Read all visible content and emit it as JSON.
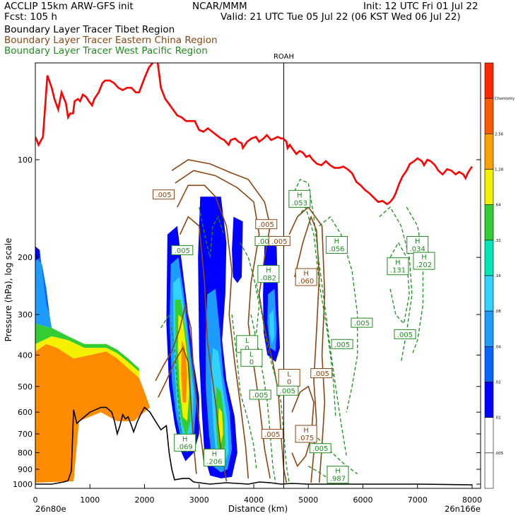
{
  "header": {
    "model": "ACCLIP 15km ARW-GFS init",
    "org": "NCAR/MMM",
    "init": "Init: 12 UTC Fri 01 Jul 22",
    "fcst": "Fcst:  105 h",
    "valid": "Valid: 21 UTC Tue 05 Jul 22 (06 KST Wed 06 Jul 22)",
    "lines": [
      "Boundary Layer Tracer  Tibet Region",
      "Boundary Layer Tracer  Eastern China Region",
      "Boundary Layer Tracer  West Pacific Region"
    ]
  },
  "chart_data": {
    "type": "heatmap",
    "xlabel": "Distance (km)",
    "ylabel": "Pressure (hPa), log scale",
    "xlim": [
      0,
      8000
    ],
    "ylim": [
      1000,
      50
    ],
    "x_ticks": [
      "0",
      "1000",
      "2000",
      "3000",
      "4000",
      "5000",
      "6000",
      "7000",
      "8000"
    ],
    "y_ticks": [
      {
        "p": 100,
        "label": "100"
      },
      {
        "p": 200,
        "label": "200"
      },
      {
        "p": 300,
        "label": "300"
      },
      {
        "p": 400,
        "label": "400"
      },
      {
        "p": 500,
        "label": "500"
      },
      {
        "p": 600,
        "label": "600"
      },
      {
        "p": 700,
        "label": "700"
      },
      {
        "p": 800,
        "label": "800"
      },
      {
        "p": 900,
        "label": "900"
      },
      {
        "p": 1000,
        "label": "1000"
      }
    ],
    "x_start_label": "26n80e",
    "x_end_label": "26n166e",
    "marker": {
      "label": "ROAH",
      "x": 4550
    },
    "colorbar": {
      "levels": [
        ".005",
        ".01",
        ".02",
        ".04",
        ".08",
        ".16",
        ".32",
        ".64",
        "1.28",
        "2.56",
        "Chemistry"
      ],
      "colors": [
        "#ffffff",
        "#ffffff",
        "#0000ff",
        "#0a64ff",
        "#1e9bff",
        "#32d2ff",
        "#00e6b4",
        "#32cd32",
        "#f0f000",
        "#ffa000",
        "#ff5a00",
        "#ff2800"
      ]
    },
    "series": [
      {
        "name": "Boundary Layer Tracer  Tibet Region",
        "color": "#ff7f00"
      },
      {
        "name": "Boundary Layer Tracer  Eastern China Region",
        "color": "#8b4513"
      },
      {
        "name": "Boundary Layer Tracer  West Pacific Region",
        "color": "#1e8c1e"
      }
    ],
    "tropopause": {
      "color": "#ff0000",
      "points": [
        [
          0,
          85
        ],
        [
          60,
          90
        ],
        [
          140,
          85
        ],
        [
          220,
          55
        ],
        [
          300,
          60
        ],
        [
          350,
          65
        ],
        [
          420,
          70
        ],
        [
          480,
          62
        ],
        [
          560,
          67
        ],
        [
          600,
          74
        ],
        [
          640,
          72
        ],
        [
          690,
          72
        ],
        [
          720,
          66
        ],
        [
          780,
          65
        ],
        [
          820,
          66
        ],
        [
          870,
          63
        ],
        [
          930,
          64
        ],
        [
          980,
          66
        ],
        [
          1040,
          68
        ],
        [
          1080,
          65
        ],
        [
          1160,
          62
        ],
        [
          1230,
          58
        ],
        [
          1280,
          57
        ],
        [
          1360,
          57
        ],
        [
          1440,
          58
        ],
        [
          1520,
          60
        ],
        [
          1600,
          61
        ],
        [
          1680,
          60
        ],
        [
          1760,
          60
        ],
        [
          1840,
          62
        ],
        [
          1900,
          62
        ],
        [
          2000,
          56
        ],
        [
          2080,
          52
        ],
        [
          2160,
          50
        ],
        [
          2240,
          50
        ],
        [
          2300,
          60
        ],
        [
          2380,
          65
        ],
        [
          2440,
          67
        ],
        [
          2520,
          70
        ],
        [
          2600,
          73
        ],
        [
          2680,
          74
        ],
        [
          2760,
          76
        ],
        [
          2840,
          76
        ],
        [
          2920,
          76
        ],
        [
          3000,
          81
        ],
        [
          3080,
          82
        ],
        [
          3160,
          80
        ],
        [
          3240,
          82
        ],
        [
          3320,
          84
        ],
        [
          3400,
          86
        ],
        [
          3460,
          87
        ],
        [
          3540,
          90
        ],
        [
          3580,
          87
        ],
        [
          3660,
          86
        ],
        [
          3720,
          88
        ],
        [
          3780,
          89
        ],
        [
          3800,
          92
        ],
        [
          3880,
          88
        ],
        [
          3960,
          86
        ],
        [
          4040,
          85
        ],
        [
          4100,
          88
        ],
        [
          4180,
          86
        ],
        [
          4240,
          84
        ],
        [
          4320,
          87
        ],
        [
          4380,
          86
        ],
        [
          4440,
          85
        ],
        [
          4500,
          86
        ],
        [
          4540,
          86
        ],
        [
          4600,
          88
        ],
        [
          4620,
          92
        ],
        [
          4660,
          90
        ],
        [
          4720,
          93
        ],
        [
          4780,
          96
        ],
        [
          4840,
          94
        ],
        [
          4900,
          95
        ],
        [
          4960,
          98
        ],
        [
          5020,
          97
        ],
        [
          5080,
          100
        ],
        [
          5160,
          103
        ],
        [
          5240,
          104
        ],
        [
          5320,
          101
        ],
        [
          5400,
          104
        ],
        [
          5480,
          106
        ],
        [
          5560,
          106
        ],
        [
          5640,
          105
        ],
        [
          5720,
          107
        ],
        [
          5800,
          110
        ],
        [
          5880,
          117
        ],
        [
          5960,
          120
        ],
        [
          6040,
          124
        ],
        [
          6120,
          127
        ],
        [
          6200,
          131
        ],
        [
          6280,
          135
        ],
        [
          6360,
          134
        ],
        [
          6440,
          137
        ],
        [
          6500,
          135
        ],
        [
          6560,
          131
        ],
        [
          6600,
          127
        ],
        [
          6660,
          119
        ],
        [
          6720,
          113
        ],
        [
          6800,
          108
        ],
        [
          6860,
          103
        ],
        [
          6940,
          101
        ],
        [
          7000,
          99
        ],
        [
          7080,
          101
        ],
        [
          7120,
          104
        ],
        [
          7180,
          100
        ],
        [
          7240,
          101
        ],
        [
          7320,
          104
        ],
        [
          7380,
          108
        ],
        [
          7460,
          111
        ],
        [
          7540,
          107
        ],
        [
          7620,
          108
        ],
        [
          7700,
          111
        ],
        [
          7760,
          109
        ],
        [
          7840,
          111
        ],
        [
          7880,
          114
        ],
        [
          7920,
          110
        ],
        [
          7980,
          106
        ],
        [
          8000,
          105
        ]
      ]
    },
    "terrain": [
      [
        0,
        1000
      ],
      [
        300,
        1000
      ],
      [
        520,
        985
      ],
      [
        600,
        975
      ],
      [
        660,
        910
      ],
      [
        700,
        590
      ],
      [
        760,
        650
      ],
      [
        850,
        630
      ],
      [
        1000,
        600
      ],
      [
        1200,
        580
      ],
      [
        1300,
        580
      ],
      [
        1400,
        600
      ],
      [
        1450,
        640
      ],
      [
        1500,
        700
      ],
      [
        1550,
        660
      ],
      [
        1600,
        610
      ],
      [
        1650,
        630
      ],
      [
        1700,
        620
      ],
      [
        1760,
        660
      ],
      [
        1800,
        690
      ],
      [
        1870,
        640
      ],
      [
        1950,
        600
      ],
      [
        2000,
        580
      ],
      [
        2050,
        590
      ],
      [
        2100,
        600
      ],
      [
        2200,
        640
      ],
      [
        2300,
        680
      ],
      [
        2400,
        660
      ],
      [
        2450,
        800
      ],
      [
        2500,
        900
      ],
      [
        2550,
        970
      ],
      [
        2700,
        960
      ],
      [
        2820,
        960
      ],
      [
        2900,
        985
      ],
      [
        3000,
        990
      ],
      [
        3200,
        1000
      ],
      [
        3500,
        990
      ],
      [
        3900,
        1000
      ],
      [
        4100,
        985
      ],
      [
        4300,
        990
      ],
      [
        4500,
        1000
      ],
      [
        4700,
        995
      ],
      [
        5000,
        1000
      ],
      [
        6000,
        1000
      ],
      [
        7000,
        1000
      ],
      [
        8000,
        1005
      ]
    ],
    "labels": [
      {
        "x": 2350,
        "p": 128,
        "text": ".005",
        "color": "#8b4513"
      },
      {
        "x": 4230,
        "p": 158,
        "text": ".005",
        "color": "#8b4513"
      },
      {
        "x": 4220,
        "p": 178,
        "text": ".005",
        "color": "#1e8c1e"
      },
      {
        "x": 4470,
        "p": 178,
        "text": ".005",
        "color": "#8b4513"
      },
      {
        "x": 2690,
        "p": 190,
        "text": ".005",
        "color": "#1e8c1e"
      },
      {
        "x": 4840,
        "p": 132,
        "text": ".053",
        "color": "#1e8c1e",
        "h": "H"
      },
      {
        "x": 5520,
        "p": 183,
        "text": ".056",
        "color": "#1e8c1e",
        "h": "H"
      },
      {
        "x": 7000,
        "p": 183,
        "text": ".034",
        "color": "#1e8c1e",
        "h": "H"
      },
      {
        "x": 6640,
        "p": 213,
        "text": ".131",
        "color": "#1e8c1e",
        "h": "H"
      },
      {
        "x": 7120,
        "p": 205,
        "text": ".202",
        "color": "#1e8c1e",
        "h": "H"
      },
      {
        "x": 4270,
        "p": 225,
        "text": ".082",
        "color": "#1e8c1e",
        "h": "H"
      },
      {
        "x": 4960,
        "p": 230,
        "text": ".060",
        "color": "#8b4513",
        "h": "H"
      },
      {
        "x": 5980,
        "p": 318,
        "text": ".005",
        "color": "#1e8c1e"
      },
      {
        "x": 6770,
        "p": 345,
        "text": ".005",
        "color": "#1e8c1e"
      },
      {
        "x": 5620,
        "p": 370,
        "text": ".005",
        "color": "#1e8c1e"
      },
      {
        "x": 3880,
        "p": 370,
        "text": "0",
        "color": "#1e8c1e",
        "h": "L"
      },
      {
        "x": 3960,
        "p": 408,
        "text": "0",
        "color": "#1e8c1e",
        "h": "L"
      },
      {
        "x": 5240,
        "p": 455,
        "text": ".005",
        "color": "#8b4513"
      },
      {
        "x": 4650,
        "p": 470,
        "text": "0",
        "color": "#8b4513",
        "h": "L"
      },
      {
        "x": 4620,
        "p": 515,
        "text": ".005",
        "color": "#1e8c1e"
      },
      {
        "x": 4120,
        "p": 530,
        "text": ".005",
        "color": "#1e8c1e"
      },
      {
        "x": 4340,
        "p": 700,
        "text": ".005",
        "color": "#8b4513"
      },
      {
        "x": 4960,
        "p": 700,
        "text": ".075",
        "color": "#8b4513",
        "h": "H"
      },
      {
        "x": 5220,
        "p": 775,
        "text": ".005",
        "color": "#1e8c1e"
      },
      {
        "x": 2740,
        "p": 745,
        "text": ".069",
        "color": "#1e8c1e",
        "h": "H"
      },
      {
        "x": 3280,
        "p": 828,
        "text": ".206",
        "color": "#1e8c1e",
        "h": "H"
      },
      {
        "x": 5540,
        "p": 935,
        "text": ".987",
        "color": "#1e8c1e",
        "h": "H"
      }
    ]
  }
}
